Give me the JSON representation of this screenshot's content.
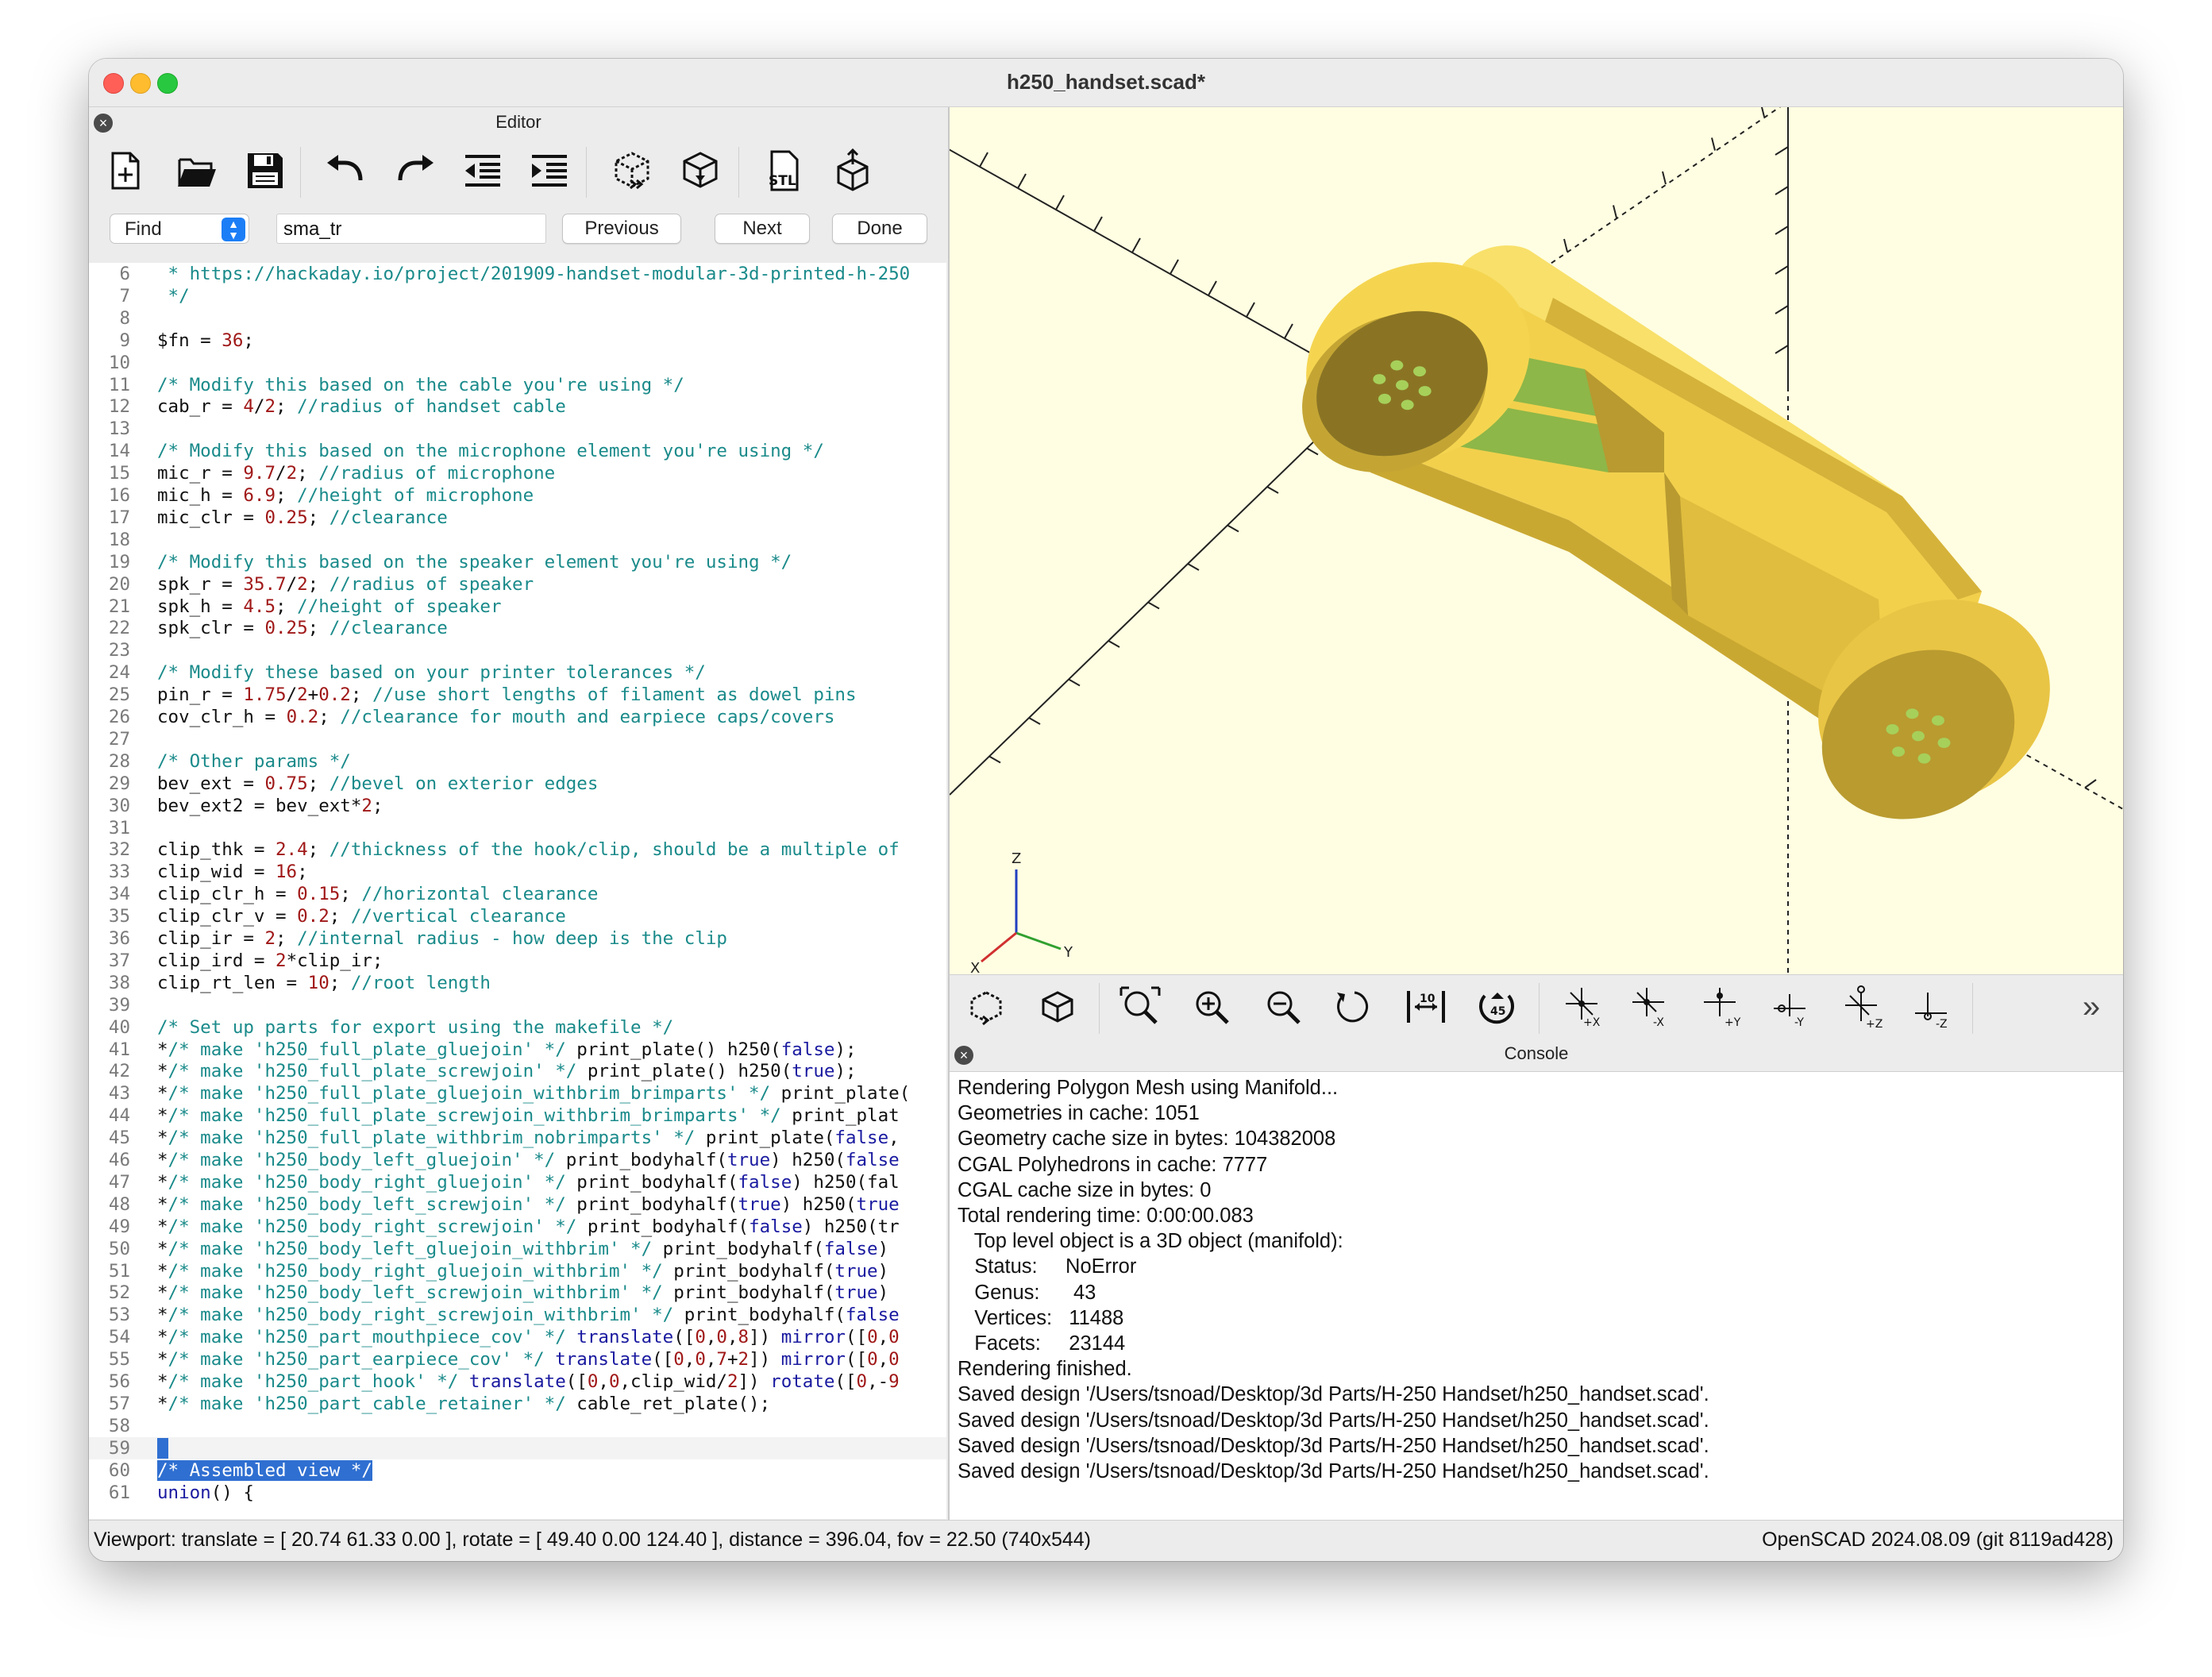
{
  "window": {
    "title": "h250_handset.scad*"
  },
  "editor": {
    "title": "Editor",
    "find": {
      "mode": "Find",
      "query": "sma_tr",
      "previous": "Previous",
      "next": "Next",
      "done": "Done"
    },
    "toolbar": [
      "new-icon",
      "open-icon",
      "save-icon",
      "undo-icon",
      "redo-icon",
      "unindent-icon",
      "indent-icon",
      "preview-icon",
      "render-icon",
      "export-stl-icon",
      "send-to-printer-icon"
    ],
    "lines": [
      {
        "n": "6",
        "t": " * https://hackaday.io/project/201909-handset-modular-3d-printed-h-250"
      },
      {
        "n": "7",
        "t": " */"
      },
      {
        "n": "8",
        "t": ""
      },
      {
        "n": "9",
        "t": "$fn = 36;"
      },
      {
        "n": "10",
        "t": ""
      },
      {
        "n": "11",
        "t": "/* Modify this based on the cable you're using */"
      },
      {
        "n": "12",
        "t": "cab_r = 4/2; //radius of handset cable"
      },
      {
        "n": "13",
        "t": ""
      },
      {
        "n": "14",
        "t": "/* Modify this based on the microphone element you're using */"
      },
      {
        "n": "15",
        "t": "mic_r = 9.7/2; //radius of microphone"
      },
      {
        "n": "16",
        "t": "mic_h = 6.9; //height of microphone"
      },
      {
        "n": "17",
        "t": "mic_clr = 0.25; //clearance"
      },
      {
        "n": "18",
        "t": ""
      },
      {
        "n": "19",
        "t": "/* Modify this based on the speaker element you're using */"
      },
      {
        "n": "20",
        "t": "spk_r = 35.7/2; //radius of speaker"
      },
      {
        "n": "21",
        "t": "spk_h = 4.5; //height of speaker"
      },
      {
        "n": "22",
        "t": "spk_clr = 0.25; //clearance"
      },
      {
        "n": "23",
        "t": ""
      },
      {
        "n": "24",
        "t": "/* Modify these based on your printer tolerances */"
      },
      {
        "n": "25",
        "t": "pin_r = 1.75/2+0.2; //use short lengths of filament as dowel pins"
      },
      {
        "n": "26",
        "t": "cov_clr_h = 0.2; //clearance for mouth and earpiece caps/covers"
      },
      {
        "n": "27",
        "t": ""
      },
      {
        "n": "28",
        "t": "/* Other params */"
      },
      {
        "n": "29",
        "t": "bev_ext = 0.75; //bevel on exterior edges"
      },
      {
        "n": "30",
        "t": "bev_ext2 = bev_ext*2;"
      },
      {
        "n": "31",
        "t": ""
      },
      {
        "n": "32",
        "t": "clip_thk = 2.4; //thickness of the hook/clip, should be a multiple of"
      },
      {
        "n": "33",
        "t": "clip_wid = 16;"
      },
      {
        "n": "34",
        "t": "clip_clr_h = 0.15; //horizontal clearance"
      },
      {
        "n": "35",
        "t": "clip_clr_v = 0.2; //vertical clearance"
      },
      {
        "n": "36",
        "t": "clip_ir = 2; //internal radius - how deep is the clip"
      },
      {
        "n": "37",
        "t": "clip_ird = 2*clip_ir;"
      },
      {
        "n": "38",
        "t": "clip_rt_len = 10; //root length"
      },
      {
        "n": "39",
        "t": ""
      },
      {
        "n": "40",
        "t": "/* Set up parts for export using the makefile */"
      },
      {
        "n": "41",
        "t": "*/* make 'h250_full_plate_gluejoin' */ print_plate() h250(false);"
      },
      {
        "n": "42",
        "t": "*/* make 'h250_full_plate_screwjoin' */ print_plate() h250(true);"
      },
      {
        "n": "43",
        "t": "*/* make 'h250_full_plate_gluejoin_withbrim_brimparts' */ print_plate("
      },
      {
        "n": "44",
        "t": "*/* make 'h250_full_plate_screwjoin_withbrim_brimparts' */ print_plat"
      },
      {
        "n": "45",
        "t": "*/* make 'h250_full_plate_withbrim_nobrimparts' */ print_plate(false,"
      },
      {
        "n": "46",
        "t": "*/* make 'h250_body_left_gluejoin' */ print_bodyhalf(true) h250(false"
      },
      {
        "n": "47",
        "t": "*/* make 'h250_body_right_gluejoin' */ print_bodyhalf(false) h250(fal"
      },
      {
        "n": "48",
        "t": "*/* make 'h250_body_left_screwjoin' */ print_bodyhalf(true) h250(true"
      },
      {
        "n": "49",
        "t": "*/* make 'h250_body_right_screwjoin' */ print_bodyhalf(false) h250(tr"
      },
      {
        "n": "50",
        "t": "*/* make 'h250_body_left_gluejoin_withbrim' */ print_bodyhalf(false)"
      },
      {
        "n": "51",
        "t": "*/* make 'h250_body_right_gluejoin_withbrim' */ print_bodyhalf(true)"
      },
      {
        "n": "52",
        "t": "*/* make 'h250_body_left_screwjoin_withbrim' */ print_bodyhalf(true)"
      },
      {
        "n": "53",
        "t": "*/* make 'h250_body_right_screwjoin_withbrim' */ print_bodyhalf(false"
      },
      {
        "n": "54",
        "t": "*/* make 'h250_part_mouthpiece_cov' */ translate([0,0,8]) mirror([0,0"
      },
      {
        "n": "55",
        "t": "*/* make 'h250_part_earpiece_cov' */ translate([0,0,7+2]) mirror([0,0"
      },
      {
        "n": "56",
        "t": "*/* make 'h250_part_hook' */ translate([0,0,clip_wid/2]) rotate([0,-9"
      },
      {
        "n": "57",
        "t": "*/* make 'h250_part_cable_retainer' */ cable_ret_plate();"
      },
      {
        "n": "58",
        "t": ""
      },
      {
        "n": "59",
        "t": ""
      },
      {
        "n": "60",
        "t": "/* Assembled view */"
      },
      {
        "n": "61",
        "t": "union() {"
      }
    ]
  },
  "viewport": {
    "toolbar": [
      "preview-icon",
      "render-icon",
      "view-all-icon",
      "zoom-in-icon",
      "zoom-out-icon",
      "reset-view-icon",
      "perspective-icon",
      "orthogonal-icon",
      "view-right-icon",
      "view-left-icon",
      "view-back-icon",
      "view-front-icon",
      "view-top-icon",
      "view-bottom-icon",
      "more-icon"
    ],
    "axis_labels": {
      "z": "Z",
      "y": "Y",
      "x": "X"
    },
    "colors": {
      "background": "#fffee2",
      "model": "#f7d34a",
      "holes": "#8fbf4a"
    }
  },
  "console": {
    "title": "Console",
    "lines": [
      "Rendering Polygon Mesh using Manifold...",
      "Geometries in cache: 1051",
      "Geometry cache size in bytes: 104382008",
      "CGAL Polyhedrons in cache: 7777",
      "CGAL cache size in bytes: 0",
      "Total rendering time: 0:00:00.083",
      "   Top level object is a 3D object (manifold):",
      "   Status:     NoError",
      "   Genus:      43",
      "   Vertices:   11488",
      "   Facets:     23144",
      "Rendering finished.",
      "Saved design '/Users/tsnoad/Desktop/3d Parts/H-250 Handset/h250_handset.scad'.",
      "Saved design '/Users/tsnoad/Desktop/3d Parts/H-250 Handset/h250_handset.scad'.",
      "Saved design '/Users/tsnoad/Desktop/3d Parts/H-250 Handset/h250_handset.scad'.",
      "Saved design '/Users/tsnoad/Desktop/3d Parts/H-250 Handset/h250_handset.scad'."
    ]
  },
  "status": {
    "viewport": "Viewport: translate = [ 20.74 61.33 0.00 ], rotate = [ 49.40 0.00 124.40 ], distance = 396.04, fov = 22.50 (740x544)",
    "version": "OpenSCAD 2024.08.09 (git 8119ad428)"
  }
}
